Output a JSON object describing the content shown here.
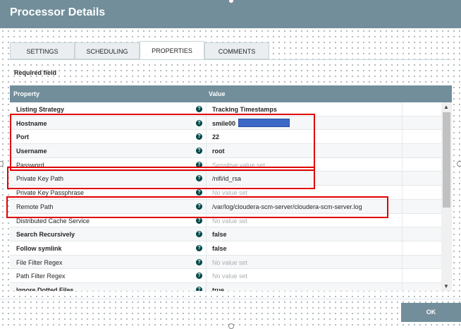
{
  "dialog": {
    "title": "Processor Details"
  },
  "tabs": [
    {
      "label": "SETTINGS",
      "active": false
    },
    {
      "label": "SCHEDULING",
      "active": false
    },
    {
      "label": "PROPERTIES",
      "active": true
    },
    {
      "label": "COMMENTS",
      "active": false
    }
  ],
  "required_field": "Required field",
  "table": {
    "columns": {
      "property": "Property",
      "value": "Value"
    },
    "rows": [
      {
        "name": "Listing Strategy",
        "required": true,
        "value": "Tracking Timestamps",
        "empty": false
      },
      {
        "name": "Hostname",
        "required": true,
        "value": "smile00",
        "empty": false
      },
      {
        "name": "Port",
        "required": true,
        "value": "22",
        "empty": false
      },
      {
        "name": "Username",
        "required": true,
        "value": "root",
        "empty": false
      },
      {
        "name": "Password",
        "required": false,
        "value": "Sensitive value set",
        "empty": true
      },
      {
        "name": "Private Key Path",
        "required": false,
        "value": "/nifi/id_rsa",
        "empty": false
      },
      {
        "name": "Private Key Passphrase",
        "required": false,
        "value": "No value set",
        "empty": true
      },
      {
        "name": "Remote Path",
        "required": false,
        "value": "/var/log/cloudera-scm-server/cloudera-scm-server.log",
        "empty": false
      },
      {
        "name": "Distributed Cache Service",
        "required": false,
        "value": "No value set",
        "empty": true
      },
      {
        "name": "Search Recursively",
        "required": true,
        "value": "false",
        "empty": false
      },
      {
        "name": "Follow symlink",
        "required": true,
        "value": "false",
        "empty": false
      },
      {
        "name": "File Filter Regex",
        "required": false,
        "value": "No value set",
        "empty": true
      },
      {
        "name": "Path Filter Regex",
        "required": false,
        "value": "No value set",
        "empty": true
      },
      {
        "name": "Ignore Dotted Files",
        "required": true,
        "value": "true",
        "empty": false
      }
    ],
    "help_icon": "?",
    "scroll": {
      "up": "▲",
      "down": "▼"
    }
  },
  "footer": {
    "ok_label": "OK"
  },
  "colors": {
    "header": "#728e9b",
    "highlight": "#e00000",
    "redaction": "#3c68c8"
  }
}
